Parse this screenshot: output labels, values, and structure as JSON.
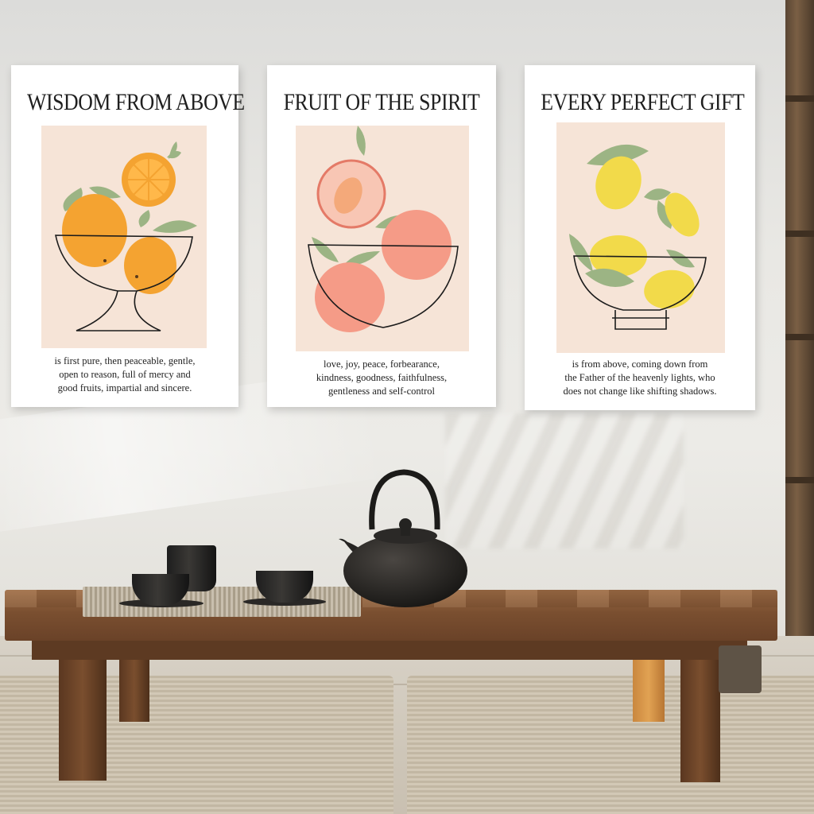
{
  "posters": [
    {
      "title": "WISDOM FROM ABOVE",
      "fruit": "oranges",
      "caption": [
        "is first pure, then peaceable, gentle,",
        "open to reason, full of mercy and",
        "good fruits, impartial and sincere."
      ]
    },
    {
      "title": "FRUIT OF THE SPIRIT",
      "fruit": "peaches",
      "caption": [
        "love, joy, peace, forbearance,",
        "kindness, goodness, faithfulness,",
        "gentleness and self-control"
      ]
    },
    {
      "title": "EVERY PERFECT GIFT",
      "fruit": "lemons",
      "caption": [
        "is from above, coming down from",
        "the Father of the heavenly lights, who",
        "does not change like shifting shadows."
      ]
    }
  ],
  "scene_objects": [
    "cast-iron-teapot",
    "tea-cup",
    "tea-cup",
    "tea-cup",
    "woven-placemat",
    "low-wooden-table",
    "floor-mat",
    "window-frame"
  ],
  "colors": {
    "orange": "#f4a331",
    "peach": "#f59b87",
    "lemon": "#f2da4a",
    "leaf": "#9cb484",
    "art_background": "#f6e4d7",
    "wood": "#7a4f30"
  }
}
